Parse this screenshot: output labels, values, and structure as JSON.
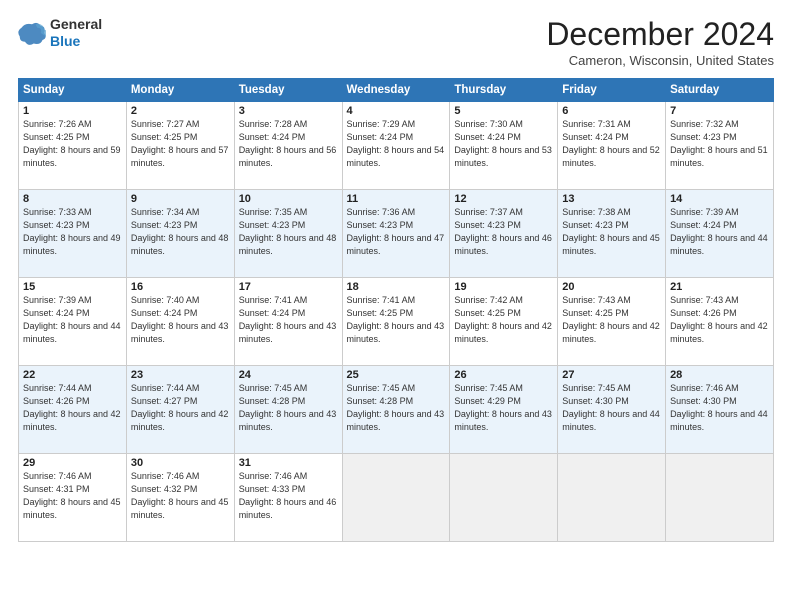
{
  "header": {
    "logo_line1": "General",
    "logo_line2": "Blue",
    "title": "December 2024",
    "location": "Cameron, Wisconsin, United States"
  },
  "days_of_week": [
    "Sunday",
    "Monday",
    "Tuesday",
    "Wednesday",
    "Thursday",
    "Friday",
    "Saturday"
  ],
  "weeks": [
    [
      {
        "day": 1,
        "sunrise": "7:26 AM",
        "sunset": "4:25 PM",
        "daylight": "8 hours and 59 minutes."
      },
      {
        "day": 2,
        "sunrise": "7:27 AM",
        "sunset": "4:25 PM",
        "daylight": "8 hours and 57 minutes."
      },
      {
        "day": 3,
        "sunrise": "7:28 AM",
        "sunset": "4:24 PM",
        "daylight": "8 hours and 56 minutes."
      },
      {
        "day": 4,
        "sunrise": "7:29 AM",
        "sunset": "4:24 PM",
        "daylight": "8 hours and 54 minutes."
      },
      {
        "day": 5,
        "sunrise": "7:30 AM",
        "sunset": "4:24 PM",
        "daylight": "8 hours and 53 minutes."
      },
      {
        "day": 6,
        "sunrise": "7:31 AM",
        "sunset": "4:24 PM",
        "daylight": "8 hours and 52 minutes."
      },
      {
        "day": 7,
        "sunrise": "7:32 AM",
        "sunset": "4:23 PM",
        "daylight": "8 hours and 51 minutes."
      }
    ],
    [
      {
        "day": 8,
        "sunrise": "7:33 AM",
        "sunset": "4:23 PM",
        "daylight": "8 hours and 49 minutes."
      },
      {
        "day": 9,
        "sunrise": "7:34 AM",
        "sunset": "4:23 PM",
        "daylight": "8 hours and 48 minutes."
      },
      {
        "day": 10,
        "sunrise": "7:35 AM",
        "sunset": "4:23 PM",
        "daylight": "8 hours and 48 minutes."
      },
      {
        "day": 11,
        "sunrise": "7:36 AM",
        "sunset": "4:23 PM",
        "daylight": "8 hours and 47 minutes."
      },
      {
        "day": 12,
        "sunrise": "7:37 AM",
        "sunset": "4:23 PM",
        "daylight": "8 hours and 46 minutes."
      },
      {
        "day": 13,
        "sunrise": "7:38 AM",
        "sunset": "4:23 PM",
        "daylight": "8 hours and 45 minutes."
      },
      {
        "day": 14,
        "sunrise": "7:39 AM",
        "sunset": "4:24 PM",
        "daylight": "8 hours and 44 minutes."
      }
    ],
    [
      {
        "day": 15,
        "sunrise": "7:39 AM",
        "sunset": "4:24 PM",
        "daylight": "8 hours and 44 minutes."
      },
      {
        "day": 16,
        "sunrise": "7:40 AM",
        "sunset": "4:24 PM",
        "daylight": "8 hours and 43 minutes."
      },
      {
        "day": 17,
        "sunrise": "7:41 AM",
        "sunset": "4:24 PM",
        "daylight": "8 hours and 43 minutes."
      },
      {
        "day": 18,
        "sunrise": "7:41 AM",
        "sunset": "4:25 PM",
        "daylight": "8 hours and 43 minutes."
      },
      {
        "day": 19,
        "sunrise": "7:42 AM",
        "sunset": "4:25 PM",
        "daylight": "8 hours and 42 minutes."
      },
      {
        "day": 20,
        "sunrise": "7:43 AM",
        "sunset": "4:25 PM",
        "daylight": "8 hours and 42 minutes."
      },
      {
        "day": 21,
        "sunrise": "7:43 AM",
        "sunset": "4:26 PM",
        "daylight": "8 hours and 42 minutes."
      }
    ],
    [
      {
        "day": 22,
        "sunrise": "7:44 AM",
        "sunset": "4:26 PM",
        "daylight": "8 hours and 42 minutes."
      },
      {
        "day": 23,
        "sunrise": "7:44 AM",
        "sunset": "4:27 PM",
        "daylight": "8 hours and 42 minutes."
      },
      {
        "day": 24,
        "sunrise": "7:45 AM",
        "sunset": "4:28 PM",
        "daylight": "8 hours and 43 minutes."
      },
      {
        "day": 25,
        "sunrise": "7:45 AM",
        "sunset": "4:28 PM",
        "daylight": "8 hours and 43 minutes."
      },
      {
        "day": 26,
        "sunrise": "7:45 AM",
        "sunset": "4:29 PM",
        "daylight": "8 hours and 43 minutes."
      },
      {
        "day": 27,
        "sunrise": "7:45 AM",
        "sunset": "4:30 PM",
        "daylight": "8 hours and 44 minutes."
      },
      {
        "day": 28,
        "sunrise": "7:46 AM",
        "sunset": "4:30 PM",
        "daylight": "8 hours and 44 minutes."
      }
    ],
    [
      {
        "day": 29,
        "sunrise": "7:46 AM",
        "sunset": "4:31 PM",
        "daylight": "8 hours and 45 minutes."
      },
      {
        "day": 30,
        "sunrise": "7:46 AM",
        "sunset": "4:32 PM",
        "daylight": "8 hours and 45 minutes."
      },
      {
        "day": 31,
        "sunrise": "7:46 AM",
        "sunset": "4:33 PM",
        "daylight": "8 hours and 46 minutes."
      },
      null,
      null,
      null,
      null
    ]
  ]
}
